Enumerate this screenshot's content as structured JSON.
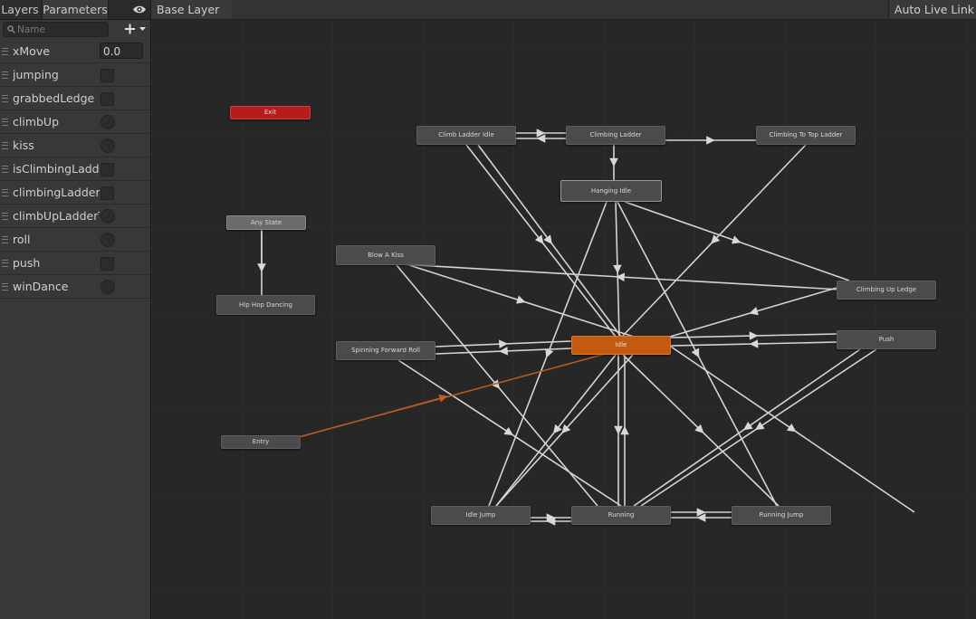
{
  "left_panel": {
    "tabs": [
      {
        "label": "Layers"
      },
      {
        "label": "Parameters"
      }
    ],
    "eye_icon": "eye-icon",
    "search": {
      "placeholder": "Name"
    },
    "add_button": {
      "icon": "plus-icon",
      "caret": "dropdown-caret-icon"
    },
    "parameters": [
      {
        "name": "xMove",
        "type": "float",
        "value": "0.0"
      },
      {
        "name": "jumping",
        "type": "bool"
      },
      {
        "name": "grabbedLedge",
        "type": "bool"
      },
      {
        "name": "climbUp",
        "type": "trigger"
      },
      {
        "name": "kiss",
        "type": "trigger"
      },
      {
        "name": "isClimbingLadde",
        "type": "bool"
      },
      {
        "name": "climbingLadder",
        "type": "bool"
      },
      {
        "name": "climbUpLadderT",
        "type": "trigger"
      },
      {
        "name": "roll",
        "type": "trigger"
      },
      {
        "name": "push",
        "type": "bool"
      },
      {
        "name": "winDance",
        "type": "trigger"
      }
    ]
  },
  "graph": {
    "breadcrumb": "Base Layer",
    "live_link_label": "Auto Live Link",
    "colors": {
      "default_state": "#c35a12",
      "exit_state": "#b51c1c",
      "transition": "#d8d8d8",
      "entry_transition": "#c0602a"
    },
    "states": {
      "exit": "Exit",
      "any_state": "Any State",
      "hip_hop": "Hip Hop Dancing",
      "entry": "Entry",
      "blow_kiss": "Blow A Kiss",
      "spin_roll": "Spinning Forward Roll",
      "climb_ladder_idle": "Climb Ladder Idle",
      "climbing_ladder": "Climbing Ladder",
      "climb_top": "Climbing To Top Ladder",
      "hanging_idle": "Hanging Idle",
      "climbing_up_ledge": "Climbing Up Ledge",
      "center": "Idle",
      "push": "Push",
      "idle_jump": "Idle Jump",
      "running": "Running",
      "running_jump": "Running Jump"
    }
  }
}
